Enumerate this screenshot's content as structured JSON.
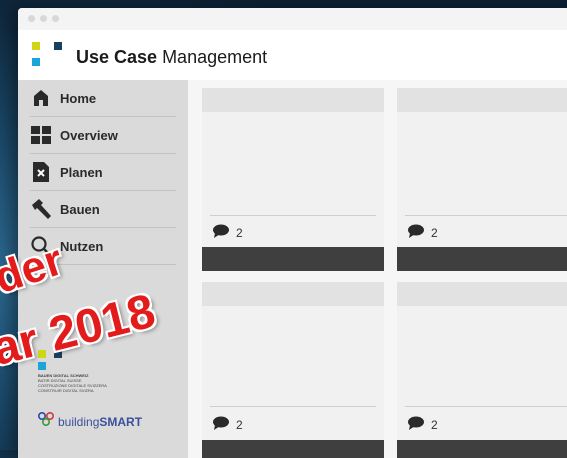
{
  "header": {
    "title_bold": "Use Case",
    "title_rest": " Management"
  },
  "brand_colors": {
    "yellow": "#cfd617",
    "navy": "#173f5f",
    "cyan": "#1aa7d8"
  },
  "sidebar": {
    "items": [
      {
        "label": "Home",
        "icon": "home-icon"
      },
      {
        "label": "Overview",
        "icon": "grid-icon"
      },
      {
        "label": "Planen",
        "icon": "document-icon"
      },
      {
        "label": "Bauen",
        "icon": "hammer-icon"
      },
      {
        "label": "Nutzen",
        "icon": "search-icon"
      }
    ],
    "partner_logo": {
      "line1": "BAUEN DIGITAL SCHWEIZ",
      "line2": "BATIR DIGITAL SUISSE",
      "line3": "COSTRUZIONE DIGITALE SVIZZERA",
      "line4": "CONSTRUIR DIGITAL SVIZRA"
    },
    "buildingsmart": {
      "part1": "building",
      "part2": "SMART"
    }
  },
  "cards": [
    {
      "comment_count": "2"
    },
    {
      "comment_count": "2"
    },
    {
      "comment_count": "2"
    },
    {
      "comment_count": "2"
    }
  ],
  "overlay": {
    "line1": "der",
    "line2": "ar 2018"
  }
}
